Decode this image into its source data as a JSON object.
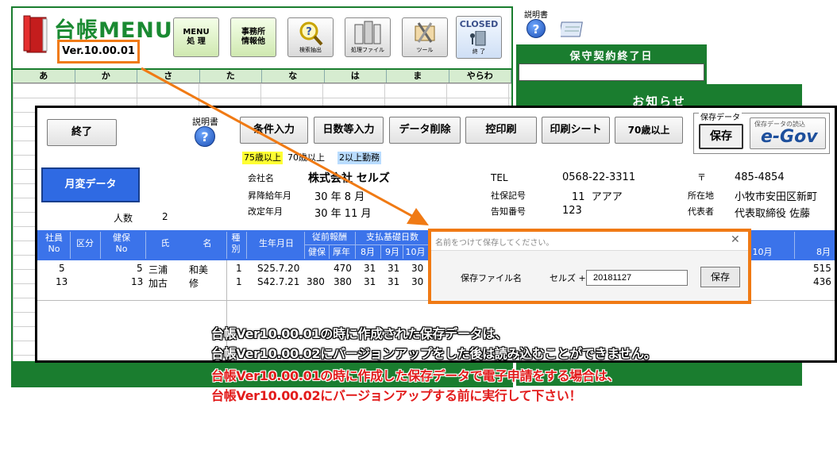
{
  "background_app": {
    "title": "台帳MENU",
    "version": "Ver.10.00.01",
    "toolbar": [
      {
        "label": "MENU\n処 理",
        "caption": ""
      },
      {
        "label": "事務所\n情報他",
        "caption": ""
      },
      {
        "label": "",
        "caption": "検索抽出"
      },
      {
        "label": "",
        "caption": "処理ファイル"
      },
      {
        "label": "",
        "caption": "ツール"
      },
      {
        "label": "CLOSED",
        "caption": "終 了"
      }
    ],
    "kana_tabs": [
      "あ",
      "か",
      "さ",
      "た",
      "な",
      "は",
      "ま",
      "やらわ"
    ],
    "manual_label": "説明書",
    "maintenance_title": "保守契約終了日",
    "notice_title": "お知らせ"
  },
  "window": {
    "exit_label": "終了",
    "manual_label": "説明書",
    "buttons": [
      "条件入力",
      "日数等入力",
      "データ削除",
      "控印刷",
      "印刷シート",
      "70歳以上"
    ],
    "save_data_label": "保存データ",
    "save_label": "保存",
    "egov_small": "保存データの読込",
    "egov_logo": "e-Gov",
    "legend": [
      {
        "text": "75歳以上",
        "color": "#ffff33"
      },
      {
        "text": "70歳以上",
        "color": "#ffffff"
      },
      {
        "text": "2以上勤務",
        "color": "#b9dcff"
      }
    ],
    "month_change_label": "月変データ",
    "headcount_label": "人数",
    "headcount_value": "2",
    "company": {
      "name_label": "会社名",
      "name_value": "株式会社 セルズ",
      "promo_label": "昇降給年月",
      "promo_value": "30 年 8 月",
      "revise_label": "改定年月",
      "revise_value": "30 年 11 月",
      "tel_label": "TEL",
      "tel_value": "0568-22-3311",
      "insurance_label": "社保記号",
      "insurance_value": "11  アアア",
      "notice_no_label": "告知番号",
      "notice_no_value": "123",
      "postal_label": "〒",
      "postal_value": "485-4854",
      "address_label": "所在地",
      "address_value": "小牧市安田区新町",
      "rep_label": "代表者",
      "rep_value": "代表取締役 佐藤"
    },
    "table": {
      "headers": {
        "emp_no": "社員\nNo",
        "category": "区分",
        "health_no": "健保\nNo",
        "surname": "氏",
        "given": "名",
        "type": "種\n別",
        "birth": "生年月日",
        "prev_salary": "従前報酬",
        "health": "健保",
        "pension": "厚年",
        "pay_days": "支払基礎日数",
        "m8": "8月",
        "m9": "9月",
        "m10": "10月",
        "m10b": "10月",
        "m8b": "8月"
      },
      "rows": [
        {
          "emp_no": "5",
          "health_no": "5",
          "surname": "三浦",
          "given": "和美",
          "type": "1",
          "birth": "S25.7.20",
          "health": "",
          "pension": "470",
          "d8": "31",
          "d9": "31",
          "d10": "30",
          "right": "515"
        },
        {
          "emp_no": "13",
          "health_no": "13",
          "surname": "加古",
          "given": "修",
          "type": "1",
          "birth": "S42.7.21",
          "health": "380",
          "pension": "380",
          "d8": "31",
          "d9": "31",
          "d10": "30",
          "right": "436"
        }
      ]
    }
  },
  "dialog": {
    "title": "名前をつけて保存してください。",
    "close": "✕",
    "field_label": "保存ファイル名",
    "prefix": "セルズ +",
    "value": "20181127",
    "save_label": "保存"
  },
  "notice_lines": [
    "台帳Ver10.00.01の時に作成された保存データは、",
    "台帳Ver10.00.02にバージョンアップをした後は読み込むことができません。",
    "台帳Ver10.00.01の時に作成した保存データで電子申請をする場合は、",
    "台帳Ver10.00.02にバージョンアップする前に実行して下さい！"
  ],
  "colors": {
    "brand_green": "#1a7d2f",
    "highlight_orange": "#f07a14",
    "header_blue": "#3b73ea",
    "warning_red": "#e21b1b"
  }
}
